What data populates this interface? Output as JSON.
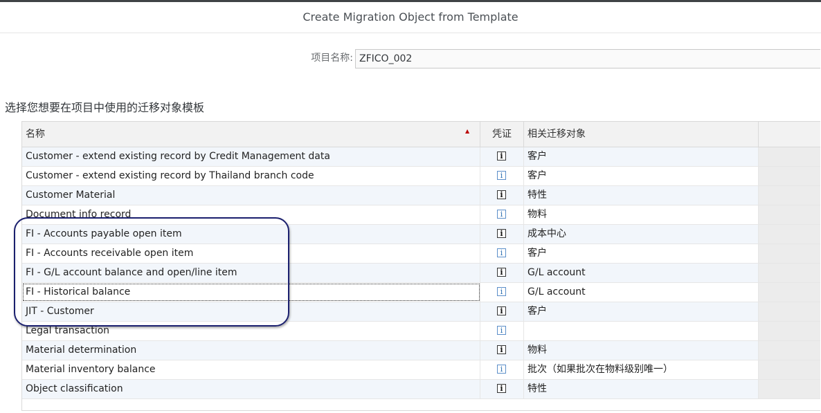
{
  "dialog": {
    "title": "Create Migration Object from Template"
  },
  "project": {
    "label": "项目名称:",
    "value": "ZFICO_002"
  },
  "section": {
    "title": "选择您想要在项目中使用的迁移对象模板"
  },
  "table": {
    "columns": {
      "name": "名称",
      "voucher": "凭证",
      "related": "相关迁移对象"
    },
    "sort": {
      "column": "name",
      "direction": "ascending",
      "icon": "sort-ascending-icon",
      "color": "#bb0000"
    },
    "rows": [
      {
        "name": "Customer - extend existing record by Credit Management data",
        "related": "客户",
        "icon": "info-icon"
      },
      {
        "name": "Customer - extend existing record by Thailand branch code",
        "related": "客户",
        "icon": "info-icon"
      },
      {
        "name": "Customer Material",
        "related": "特性",
        "icon": "info-icon"
      },
      {
        "name": "Document info record",
        "related": "物料",
        "icon": "info-icon"
      },
      {
        "name": "FI - Accounts payable open item",
        "related": "成本中心",
        "icon": "info-icon"
      },
      {
        "name": "FI - Accounts receivable open item",
        "related": "客户",
        "icon": "info-icon"
      },
      {
        "name": "FI - G/L account balance and open/line item",
        "related": "G/L account",
        "icon": "info-icon"
      },
      {
        "name": "FI - Historical balance",
        "related": "G/L account",
        "icon": "info-icon",
        "selected": true
      },
      {
        "name": "JIT - Customer",
        "related": "客户",
        "icon": "info-icon"
      },
      {
        "name": "Legal transaction",
        "related": "",
        "icon": "info-icon"
      },
      {
        "name": "Material determination",
        "related": "物料",
        "icon": "info-icon"
      },
      {
        "name": "Material inventory balance",
        "related": "批次（如果批次在物料级别唯一）",
        "icon": "info-icon"
      },
      {
        "name": "Object classification",
        "related": "特性",
        "icon": "info-icon"
      }
    ]
  },
  "annotation": {
    "color": "#1a1f6e"
  }
}
